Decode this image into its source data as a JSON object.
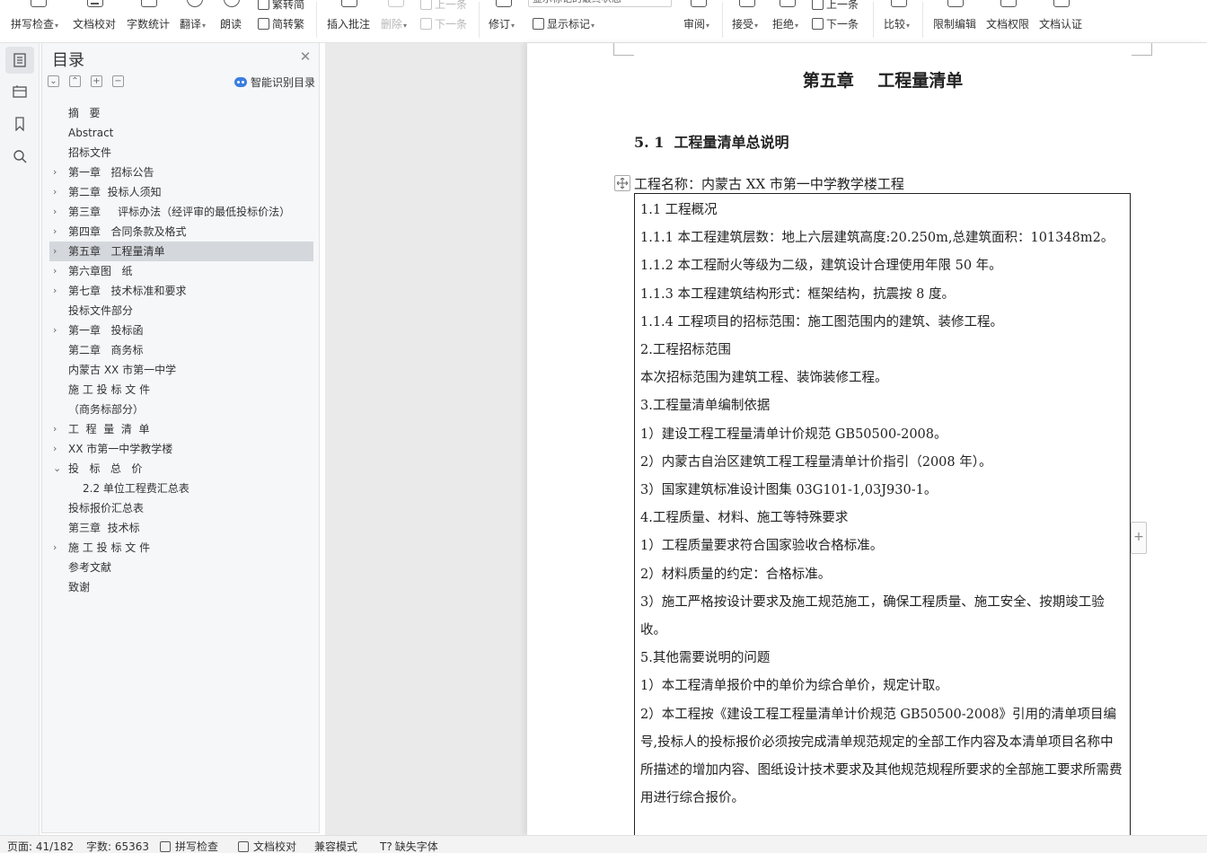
{
  "ribbon": {
    "buttons": [
      {
        "label": "拼写检查",
        "caret": true
      },
      {
        "label": "文档校对",
        "caret": false
      },
      {
        "label": "字数统计",
        "caret": false
      },
      {
        "label": "翻译",
        "caret": true
      },
      {
        "label": "朗读",
        "caret": false
      },
      {
        "label": "繁转简",
        "caret": false
      },
      {
        "label": "简转繁",
        "caret": false
      },
      {
        "label": "插入批注",
        "caret": false
      },
      {
        "label": "删除",
        "caret": true
      },
      {
        "label": "上一条",
        "caret": false
      },
      {
        "label": "下一条",
        "caret": false
      },
      {
        "label": "修订",
        "caret": true
      },
      {
        "label": "显示标记",
        "caret": true
      },
      {
        "label": "审阅",
        "caret": true
      },
      {
        "label": "接受",
        "caret": true
      },
      {
        "label": "拒绝",
        "caret": true
      },
      {
        "label": "上一条",
        "caret": false
      },
      {
        "label": "下一条",
        "caret": false
      },
      {
        "label": "比较",
        "caret": true
      },
      {
        "label": "限制编辑",
        "caret": false
      },
      {
        "label": "文档权限",
        "caret": false
      },
      {
        "label": "文档认证",
        "caret": false
      }
    ],
    "markup_combo_value": "显示标记的最终状态"
  },
  "toc": {
    "title": "目录",
    "smart_label": "智能识别目录",
    "items": [
      {
        "text": "摘   要",
        "arrow": ""
      },
      {
        "text": "Abstract",
        "arrow": ""
      },
      {
        "text": "招标文件",
        "arrow": ""
      },
      {
        "text": "第一章   招标公告",
        "arrow": "›"
      },
      {
        "text": "第二章  投标人须知",
        "arrow": "›"
      },
      {
        "text": "第三章     评标办法（经评审的最低投标价法）",
        "arrow": "›"
      },
      {
        "text": "第四章   合同条款及格式",
        "arrow": "›"
      },
      {
        "text": "第五章   工程量清单",
        "arrow": "›",
        "selected": true
      },
      {
        "text": "第六章图   纸",
        "arrow": "›"
      },
      {
        "text": "第七章   技术标准和要求",
        "arrow": "›"
      },
      {
        "text": "投标文件部分",
        "arrow": ""
      },
      {
        "text": "第一章   投标函",
        "arrow": "›"
      },
      {
        "text": "第二章   商务标",
        "arrow": ""
      },
      {
        "text": "内蒙古 XX 市第一中学",
        "arrow": ""
      },
      {
        "text": "施 工 投 标 文 件",
        "arrow": ""
      },
      {
        "text": "（商务标部分）",
        "arrow": ""
      },
      {
        "text": "工  程  量  清  单",
        "arrow": "›"
      },
      {
        "text": "XX 市第一中学教学楼",
        "arrow": "›"
      },
      {
        "text": "投   标   总   价",
        "arrow": "⌄"
      },
      {
        "text": "2.2 单位工程费汇总表",
        "arrow": "",
        "level": 2
      },
      {
        "text": "投标报价汇总表",
        "arrow": ""
      },
      {
        "text": "第三章  技术标",
        "arrow": ""
      },
      {
        "text": "施 工 投 标 文 件",
        "arrow": "›"
      },
      {
        "text": "参考文献",
        "arrow": ""
      },
      {
        "text": "致谢",
        "arrow": ""
      }
    ]
  },
  "document": {
    "chapter_title": "第五章    工程量清单",
    "section_title": "5. 1  工程量清单总说明",
    "project_name": "工程名称：内蒙古 XX 市第一中学教学楼工程",
    "paragraphs": [
      "1.1 工程概况",
      "1.1.1 本工程建筑层数：地上六层建筑高度:20.250m,总建筑面积：101348m2。",
      "1.1.2 本工程耐火等级为二级，建筑设计合理使用年限 50 年。",
      "1.1.3 本工程建筑结构形式：框架结构，抗震按 8 度。",
      "1.1.4 工程项目的招标范围：施工图范围内的建筑、装修工程。",
      "2.工程招标范围",
      "本次招标范围为建筑工程、装饰装修工程。",
      "3.工程量清单编制依据",
      "1）建设工程工程量清单计价规范 GB50500-2008。",
      "2）内蒙古自治区建筑工程工程量清单计价指引（2008 年）。",
      "3）国家建筑标准设计图集 03G101-1,03J930-1。",
      "4.工程质量、材料、施工等特殊要求",
      "1）工程质量要求符合国家验收合格标准。",
      "2）材料质量的约定：合格标准。",
      "3）施工严格按设计要求及施工规范施工，确保工程质量、施工安全、按期竣工验收。",
      "5.其他需要说明的问题",
      "1）本工程清单报价中的单价为综合单价，规定计取。",
      "2）本工程按《建设工程工程量清单计价规范 GB50500-2008》引用的清单项目编号,投标人的投标报价必须按完成清单规范规定的全部工作内容及本清单项目名称中所描述的增加内容、图纸设计技术要求及其他规范规程所要求的全部施工要求所需费用进行综合报价。"
    ]
  },
  "status_bar": {
    "page": "页面: 41/182",
    "word_count": "字数: 65363",
    "spell_check": "拼写检查",
    "proofread": "文档校对",
    "compat_mode": "兼容模式",
    "missing_font": "缺失字体"
  }
}
